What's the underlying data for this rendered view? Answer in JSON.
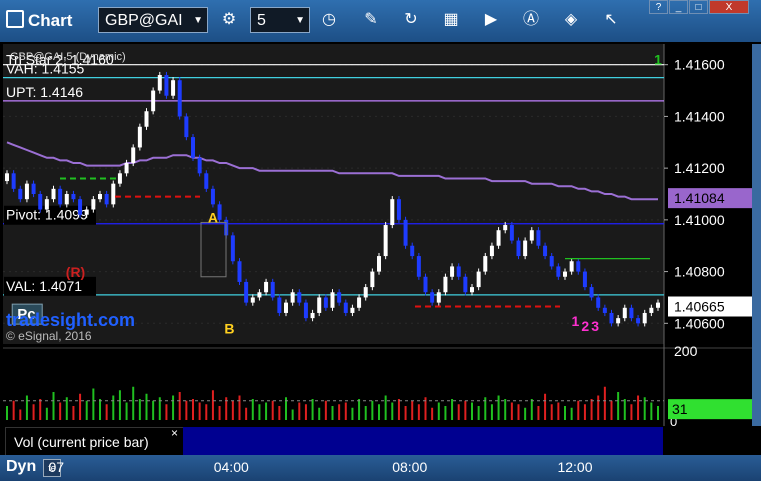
{
  "toolbar": {
    "title": "Chart",
    "symbol": "GBP@GAI",
    "interval": "5",
    "icons": [
      "gear-icon",
      "clock-icon",
      "pencil-icon",
      "cycle-icon",
      "grid-icon",
      "play-icon",
      "alert-icon",
      "tag-icon",
      "cursor-icon"
    ],
    "window_buttons": [
      "?",
      "_",
      "□",
      "X"
    ]
  },
  "status": {
    "mode": "Dyn",
    "mode_box": "fe"
  },
  "volume_panel": {
    "label": "Vol (current price bar)",
    "close_label": "×"
  },
  "chart_data": {
    "type": "candlestick",
    "colors": {
      "up": "#ffffff",
      "down": "#1e3cff",
      "pivot": "#2020ff",
      "ma": "#9b6fd4",
      "val": "#40d0e0",
      "upt": "#c080ff",
      "green": "#20c020",
      "red": "#e01010",
      "magenta": "#ff30d0",
      "yellow": "#ffd020",
      "price_badge": "#9966cc",
      "vol_badge": "#30e030"
    },
    "y_axis": {
      "min": 1.4052,
      "max": 1.4168,
      "ticks": [
        "1.40600",
        "1.40800",
        "1.41000",
        "1.41200",
        "1.41400",
        "1.41600"
      ]
    },
    "x_ticks": [
      {
        "label": "07",
        "x": 0.09
      },
      {
        "label": "04:00",
        "x": 0.34
      },
      {
        "label": "08:00",
        "x": 0.61
      },
      {
        "label": "12:00",
        "x": 0.86
      }
    ],
    "levels": [
      {
        "name": "Tri Star 2: 1.4160",
        "value": 1.416,
        "label": "Tri Star 2: 1.4160",
        "color": "#ffffff"
      },
      {
        "name": "VAH",
        "value": 1.4155,
        "label": "VAH: 1.4155",
        "color": "#40d0e0"
      },
      {
        "name": "UPT",
        "value": 1.4146,
        "label": "UPT: 1.4146",
        "color": "#c080ff"
      },
      {
        "name": "Pivot",
        "value": 1.40985,
        "label": "Pivot: 1.4099",
        "color": "#2020ff"
      },
      {
        "name": "VAL",
        "value": 1.4071,
        "label": "VAL: 1.4071",
        "color": "#40d0e0"
      }
    ],
    "legend_text": "GBP@GAI,5 (Dynamic)",
    "subtitle_text": "© eSignal, 2016",
    "watermark": "tradesight.com",
    "price_badge": "1.41084",
    "last_price_badge": "1.40665",
    "volume_axis": {
      "top_label": "200",
      "zero_label": "0",
      "badge": "31"
    },
    "annotations": [
      {
        "text": "A",
        "x": 0.31,
        "y": 1.4099,
        "color": "#ffd020"
      },
      {
        "text": "B",
        "x": 0.335,
        "y": 1.4056,
        "color": "#ffd020"
      },
      {
        "text": "(R)",
        "x": 0.095,
        "y": 1.4078,
        "color": "#cc2020"
      },
      {
        "text": "1",
        "x": 0.86,
        "y": 1.4059,
        "color": "#ff30d0"
      },
      {
        "text": "2",
        "x": 0.875,
        "y": 1.4057,
        "color": "#ff30d0"
      },
      {
        "text": "3",
        "x": 0.89,
        "y": 1.4057,
        "color": "#ff30d0"
      },
      {
        "text": "1",
        "x": 0.985,
        "y": 1.416,
        "color": "#20c020"
      },
      {
        "text": "Pc",
        "x": 0.02,
        "y": 1.4062,
        "color": "#20c020"
      }
    ],
    "closes": [
      1.4118,
      1.4112,
      1.4108,
      1.4114,
      1.411,
      1.4104,
      1.4108,
      1.4112,
      1.4106,
      1.411,
      1.4108,
      1.4102,
      1.4104,
      1.4108,
      1.411,
      1.4106,
      1.4114,
      1.4118,
      1.4122,
      1.4128,
      1.4136,
      1.4142,
      1.415,
      1.4156,
      1.4148,
      1.4154,
      1.414,
      1.4132,
      1.4124,
      1.4118,
      1.4112,
      1.4106,
      1.41,
      1.4094,
      1.4084,
      1.4076,
      1.4068,
      1.407,
      1.4072,
      1.4076,
      1.407,
      1.4064,
      1.4068,
      1.4072,
      1.4068,
      1.4062,
      1.4064,
      1.407,
      1.4066,
      1.4072,
      1.4068,
      1.4064,
      1.4066,
      1.407,
      1.4074,
      1.408,
      1.4086,
      1.4098,
      1.4108,
      1.41,
      1.409,
      1.4086,
      1.4078,
      1.4072,
      1.4068,
      1.4072,
      1.4078,
      1.4082,
      1.4078,
      1.4072,
      1.4074,
      1.408,
      1.4086,
      1.409,
      1.4096,
      1.4098,
      1.4092,
      1.4086,
      1.4092,
      1.4096,
      1.409,
      1.4086,
      1.4082,
      1.4078,
      1.408,
      1.4084,
      1.408,
      1.4074,
      1.407,
      1.4066,
      1.4064,
      1.406,
      1.4062,
      1.4066,
      1.4062,
      1.406,
      1.4064,
      1.4066,
      1.4068
    ],
    "ma": [
      1.413,
      1.4129,
      1.4128,
      1.4127,
      1.4126,
      1.4125,
      1.4124,
      1.4124,
      1.4123,
      1.4123,
      1.4122,
      1.4122,
      1.4121,
      1.4121,
      1.4121,
      1.4121,
      1.4121,
      1.4121,
      1.4122,
      1.4122,
      1.4123,
      1.4123,
      1.4124,
      1.4124,
      1.4124,
      1.4125,
      1.4125,
      1.4125,
      1.4124,
      1.4124,
      1.4123,
      1.4123,
      1.4122,
      1.4122,
      1.4121,
      1.412,
      1.412,
      1.412,
      1.4119,
      1.4119,
      1.4119,
      1.4119,
      1.4119,
      1.4119,
      1.4119,
      1.4119,
      1.4119,
      1.4119,
      1.4119,
      1.4119,
      1.4118,
      1.4118,
      1.4118,
      1.4118,
      1.4118,
      1.4118,
      1.4118,
      1.4118,
      1.4118,
      1.4117,
      1.4117,
      1.4117,
      1.4117,
      1.4117,
      1.4117,
      1.4117,
      1.4116,
      1.4116,
      1.4116,
      1.4116,
      1.4116,
      1.4116,
      1.4116,
      1.4115,
      1.4115,
      1.4115,
      1.4115,
      1.4115,
      1.4115,
      1.4114,
      1.4114,
      1.4114,
      1.4114,
      1.4113,
      1.4113,
      1.4113,
      1.4112,
      1.4112,
      1.4111,
      1.4111,
      1.411,
      1.411,
      1.4109,
      1.4109,
      1.4108,
      1.4108,
      1.4108,
      1.4108,
      1.4108
    ],
    "volumes": [
      40,
      55,
      30,
      70,
      45,
      60,
      35,
      80,
      50,
      65,
      40,
      75,
      55,
      90,
      60,
      45,
      70,
      85,
      50,
      95,
      60,
      75,
      55,
      65,
      45,
      70,
      80,
      55,
      60,
      50,
      45,
      85,
      40,
      65,
      55,
      70,
      35,
      60,
      45,
      50,
      55,
      40,
      65,
      30,
      50,
      45,
      60,
      35,
      55,
      40,
      45,
      50,
      35,
      60,
      40,
      55,
      45,
      70,
      50,
      60,
      40,
      55,
      45,
      65,
      35,
      50,
      40,
      60,
      45,
      55,
      50,
      40,
      65,
      45,
      70,
      60,
      50,
      45,
      35,
      60,
      40,
      75,
      45,
      50,
      40,
      35,
      55,
      45,
      60,
      70,
      95,
      55,
      80,
      60,
      45,
      70,
      65,
      50,
      40
    ]
  }
}
